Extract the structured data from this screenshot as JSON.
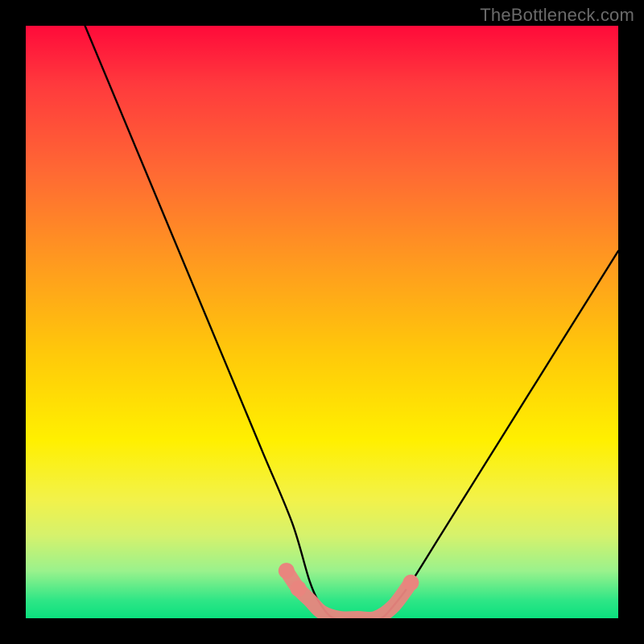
{
  "attribution": "TheBottleneck.com",
  "chart_data": {
    "type": "line",
    "title": "",
    "xlabel": "",
    "ylabel": "",
    "xlim": [
      0,
      100
    ],
    "ylim": [
      0,
      100
    ],
    "series": [
      {
        "name": "bottleneck-curve",
        "x": [
          10,
          15,
          20,
          25,
          30,
          35,
          40,
          45,
          48,
          50,
          52,
          55,
          58,
          60,
          62,
          65,
          70,
          75,
          80,
          85,
          90,
          95,
          100
        ],
        "values": [
          100,
          88,
          76,
          64,
          52,
          40,
          28,
          16,
          6,
          2,
          0,
          0,
          0,
          0,
          2,
          6,
          14,
          22,
          30,
          38,
          46,
          54,
          62
        ]
      }
    ],
    "markers": {
      "name": "highlight-dots",
      "x": [
        44,
        46,
        48,
        50,
        53,
        56,
        59,
        62,
        65
      ],
      "values": [
        8,
        5,
        3,
        1,
        0,
        0,
        0,
        2,
        6
      ]
    }
  }
}
